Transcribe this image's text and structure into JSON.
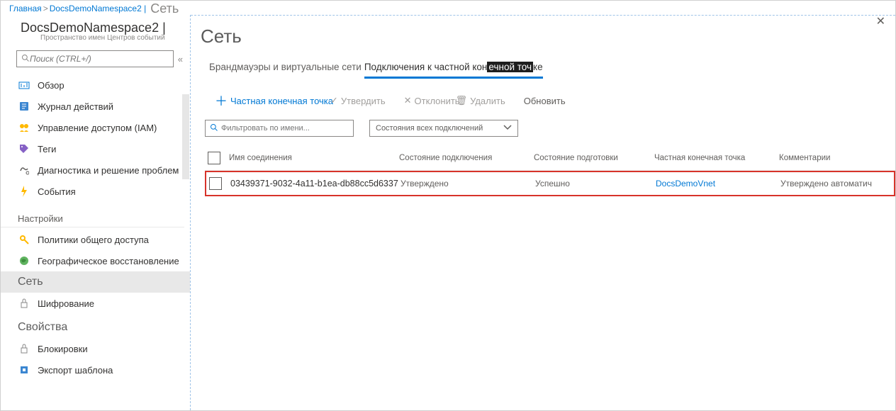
{
  "breadcrumb": {
    "home": "Главная",
    "sep": ">",
    "ns": "DocsDemoNamespace2 |",
    "tail": "Сеть"
  },
  "sidebar": {
    "title": "DocsDemoNamespace2 |",
    "subtitle": "Пространство имен Центров событий",
    "search_placeholder": "Поиск (CTRL+/)",
    "items": {
      "overview": "Обзор",
      "activity": "Журнал действий",
      "iam": "Управление доступом (IAM)",
      "tags": "Теги",
      "diagnose": "Диагностика и решение проблем",
      "events": "События"
    },
    "settings_label": "Настройки",
    "settings": {
      "shared": "Политики общего доступа",
      "geo": "Географическое восстановление",
      "network": "Сеть",
      "encryption": "Шифрование"
    },
    "properties_label": "Свойства",
    "properties": {
      "locks": "Блокировки",
      "export": "Экспорт шаблона"
    }
  },
  "main": {
    "title": "Сеть",
    "tabs": {
      "firewalls": "Брандмауэры и виртуальные сети",
      "private_pre": "Подключения к частной кон",
      "private_mid": "ечной точ",
      "private_post": "ке"
    },
    "toolbar": {
      "add": "Частная конечная точка",
      "approve": "Утвердить",
      "reject": "Отклонить",
      "delete": "Удалить",
      "refresh": "Обновить"
    },
    "filter_placeholder": "Фильтровать по имени...",
    "select_label": "Состояния всех подключений",
    "columns": {
      "name": "Имя соединения",
      "state": "Состояние подключения",
      "provision": "Состояние подготовки",
      "endpoint": "Частная конечная точка",
      "comments": "Комментарии"
    },
    "row": {
      "name": "03439371-9032-4a11-b1ea-db88cc5d6337",
      "state": "Утверждено",
      "provision": "Успешно",
      "endpoint": "DocsDemoVnet",
      "comments": "Утверждено автоматич"
    }
  }
}
